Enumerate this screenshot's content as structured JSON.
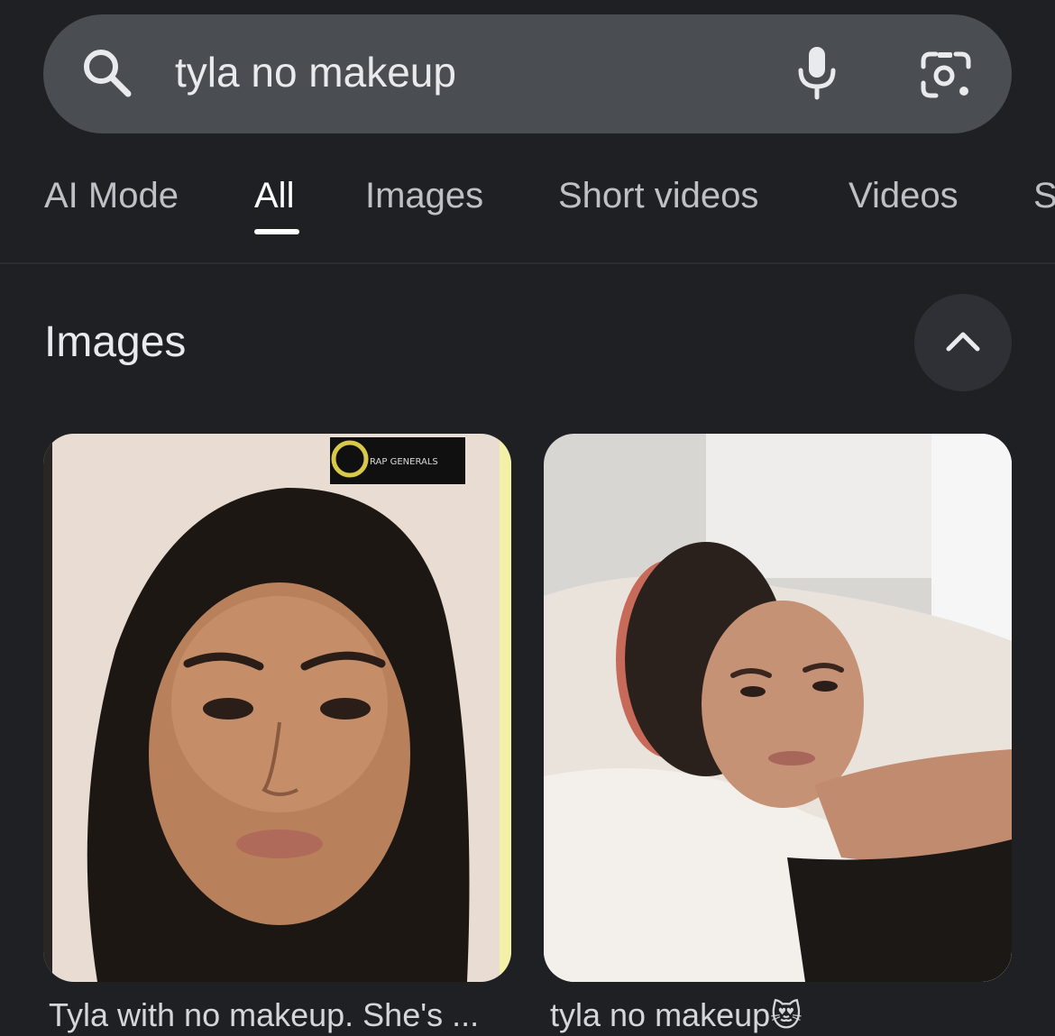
{
  "search": {
    "query": "tyla no makeup"
  },
  "tabs": [
    {
      "label": "AI Mode"
    },
    {
      "label": "All",
      "active": true
    },
    {
      "label": "Images"
    },
    {
      "label": "Short videos"
    },
    {
      "label": "Videos"
    },
    {
      "label": "S"
    }
  ],
  "images_section": {
    "title": "Images",
    "results": [
      {
        "caption": "Tyla with no makeup. She's ...",
        "watermark": "RAP GENERALS"
      },
      {
        "caption": "tyla no makeup",
        "caption_emoji": "😻"
      }
    ]
  },
  "colors": {
    "background": "#1f2024",
    "search_bar": "#4a4d52",
    "tab_active": "#ffffff",
    "tab_inactive": "#bdc1c6"
  },
  "icons": [
    "search-icon",
    "microphone-icon",
    "camera-lens-icon",
    "chevron-up-icon"
  ]
}
